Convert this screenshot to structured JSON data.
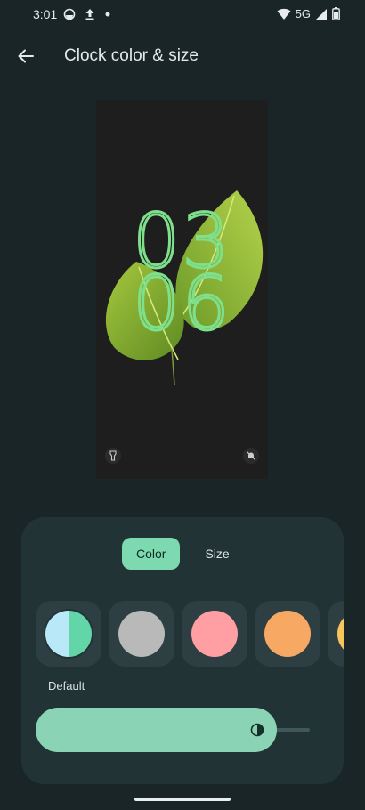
{
  "status_bar": {
    "time": "3:01",
    "network": "5G",
    "icons": [
      "data-saver-icon",
      "upload-icon",
      "notification-dot-icon",
      "wifi-icon",
      "signal-icon",
      "battery-icon"
    ]
  },
  "app_bar": {
    "title": "Clock color & size",
    "back_icon": "arrow-back-icon"
  },
  "preview": {
    "clock_hours": "03",
    "clock_minutes": "06",
    "clock_color": "#7ee08c",
    "shortcut_left_icon": "flashlight-icon",
    "shortcut_right_icon": "do-not-disturb-icon"
  },
  "sheet": {
    "tabs": [
      {
        "label": "Color",
        "selected": true
      },
      {
        "label": "Size",
        "selected": false
      }
    ],
    "swatches": [
      {
        "name": "default",
        "colors": [
          "#b9e8f8",
          "#63d6a9"
        ],
        "selected": true
      },
      {
        "name": "gray",
        "colors": [
          "#b9b9b9"
        ]
      },
      {
        "name": "pink",
        "colors": [
          "#ff9fa4"
        ]
      },
      {
        "name": "orange",
        "colors": [
          "#f7a964"
        ]
      },
      {
        "name": "yellow",
        "colors": [
          "#f6c55b"
        ]
      }
    ],
    "selected_label": "Default",
    "tone_slider": {
      "value_fraction": 0.84,
      "icon": "contrast-icon"
    }
  },
  "colors": {
    "background": "#192527",
    "sheet": "#223336",
    "accent": "#7dd9b0",
    "slider_fill": "#8ad4b5"
  }
}
